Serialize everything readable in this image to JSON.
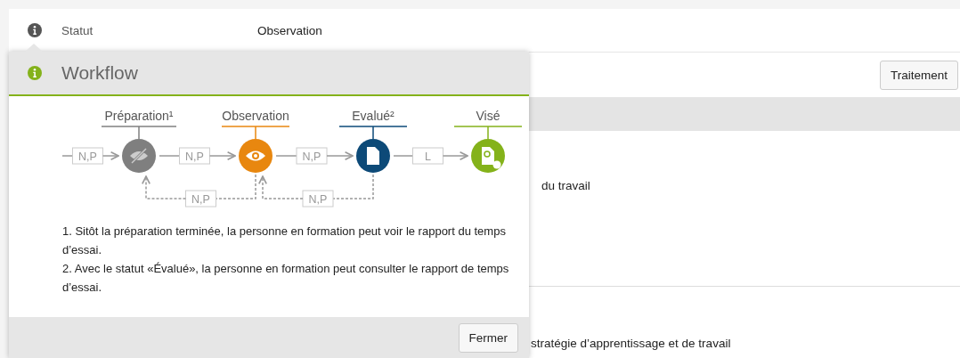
{
  "header": {
    "label": "Statut",
    "value": "Observation"
  },
  "toolbar": {
    "button": "Traitement"
  },
  "content": {
    "line_1": "du travail",
    "line_2": "stratégie d’apprentissage et de travail"
  },
  "popover": {
    "title": "Workflow",
    "stages": [
      {
        "label": "Préparation¹",
        "kind": "hidden",
        "color": "#7f7f7f"
      },
      {
        "label": "Observation",
        "kind": "eye",
        "color": "#e8870f"
      },
      {
        "label": "Evalué²",
        "kind": "document",
        "color": "#0d4a78"
      },
      {
        "label": "Visé",
        "kind": "certificate",
        "color": "#84b21a"
      }
    ],
    "forward": [
      "N,P",
      "N,P",
      "N,P",
      "L"
    ],
    "back": [
      "N,P",
      "N,P"
    ],
    "notes": [
      "1. Sitôt la préparation terminée, la personne en formation peut voir le rapport du temps d’essai.",
      "2. Avec le statut «Évalué», la personne en formation peut consulter le rapport de temps d’essai."
    ],
    "close_button": "Fermer"
  }
}
